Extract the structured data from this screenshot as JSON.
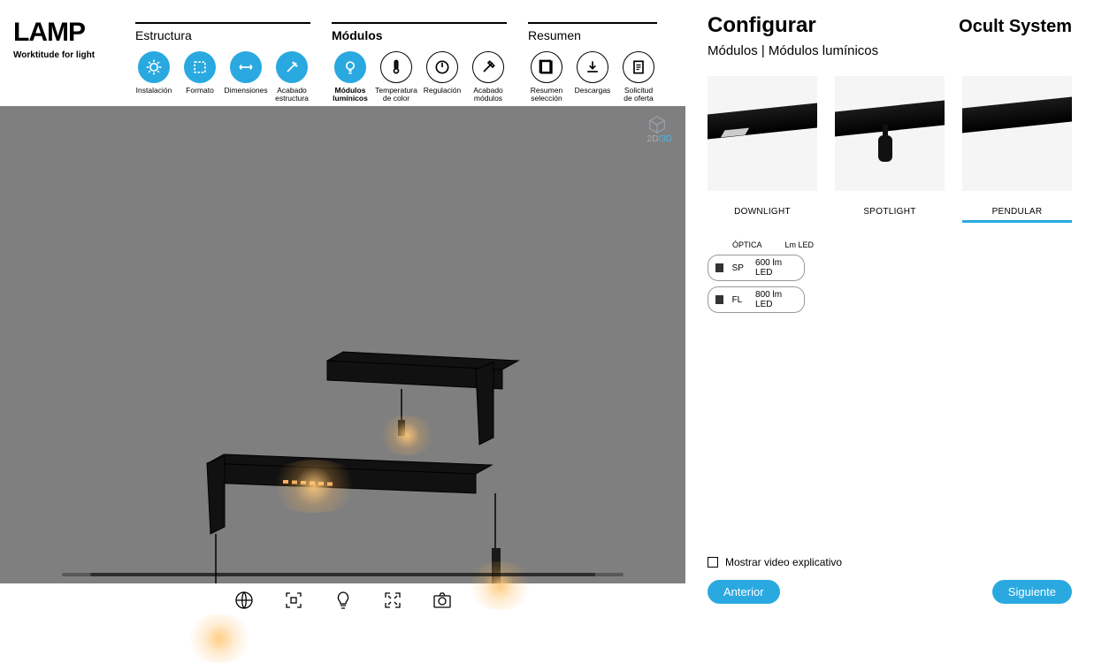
{
  "logo": {
    "brand": "LAMP",
    "tagline": "Worktitude for light",
    "cut": "/"
  },
  "stepGroups": [
    {
      "title": "Estructura",
      "bold": false,
      "steps": [
        {
          "key": "instalacion",
          "label": "Instalación",
          "active": true
        },
        {
          "key": "formato",
          "label": "Formato",
          "active": true
        },
        {
          "key": "dimensiones",
          "label": "Dimensiones",
          "active": true
        },
        {
          "key": "acabado-estructura",
          "label": "Acabado estructura",
          "active": true
        }
      ]
    },
    {
      "title": "Módulos",
      "bold": true,
      "steps": [
        {
          "key": "modulos-luminicos",
          "label": "Módulos lumínicos",
          "active": true,
          "boldLabel": true
        },
        {
          "key": "temperatura",
          "label": "Temperatura de color",
          "active": false
        },
        {
          "key": "regulacion",
          "label": "Regulación",
          "active": false
        },
        {
          "key": "acabado-modulos",
          "label": "Acabado módulos",
          "active": false
        }
      ]
    },
    {
      "title": "Resumen",
      "bold": false,
      "steps": [
        {
          "key": "resumen-seleccion",
          "label": "Resumen selección",
          "active": false
        },
        {
          "key": "descargas",
          "label": "Descargas",
          "active": false
        },
        {
          "key": "solicitud-oferta",
          "label": "Solicitud de oferta",
          "active": false
        }
      ]
    }
  ],
  "viewer": {
    "badge2d": "2D",
    "badge3d": "/3D"
  },
  "panel": {
    "title": "Configurar",
    "product": "Ocult System",
    "breadcrumb": "Módulos | Módulos lumínicos",
    "cards": [
      {
        "name": "DOWNLIGHT",
        "selected": false
      },
      {
        "name": "SPOTLIGHT",
        "selected": false
      },
      {
        "name": "PENDULAR",
        "selected": true
      }
    ],
    "optHeaders": {
      "optica": "ÓPTICA",
      "lm": "Lm LED"
    },
    "options": [
      {
        "code": "SP",
        "lm": "600 lm LED"
      },
      {
        "code": "FL",
        "lm": "800 lm LED"
      }
    ],
    "showVideo": "Mostrar video explicativo",
    "prev": "Anterior",
    "next": "Siguiente"
  }
}
